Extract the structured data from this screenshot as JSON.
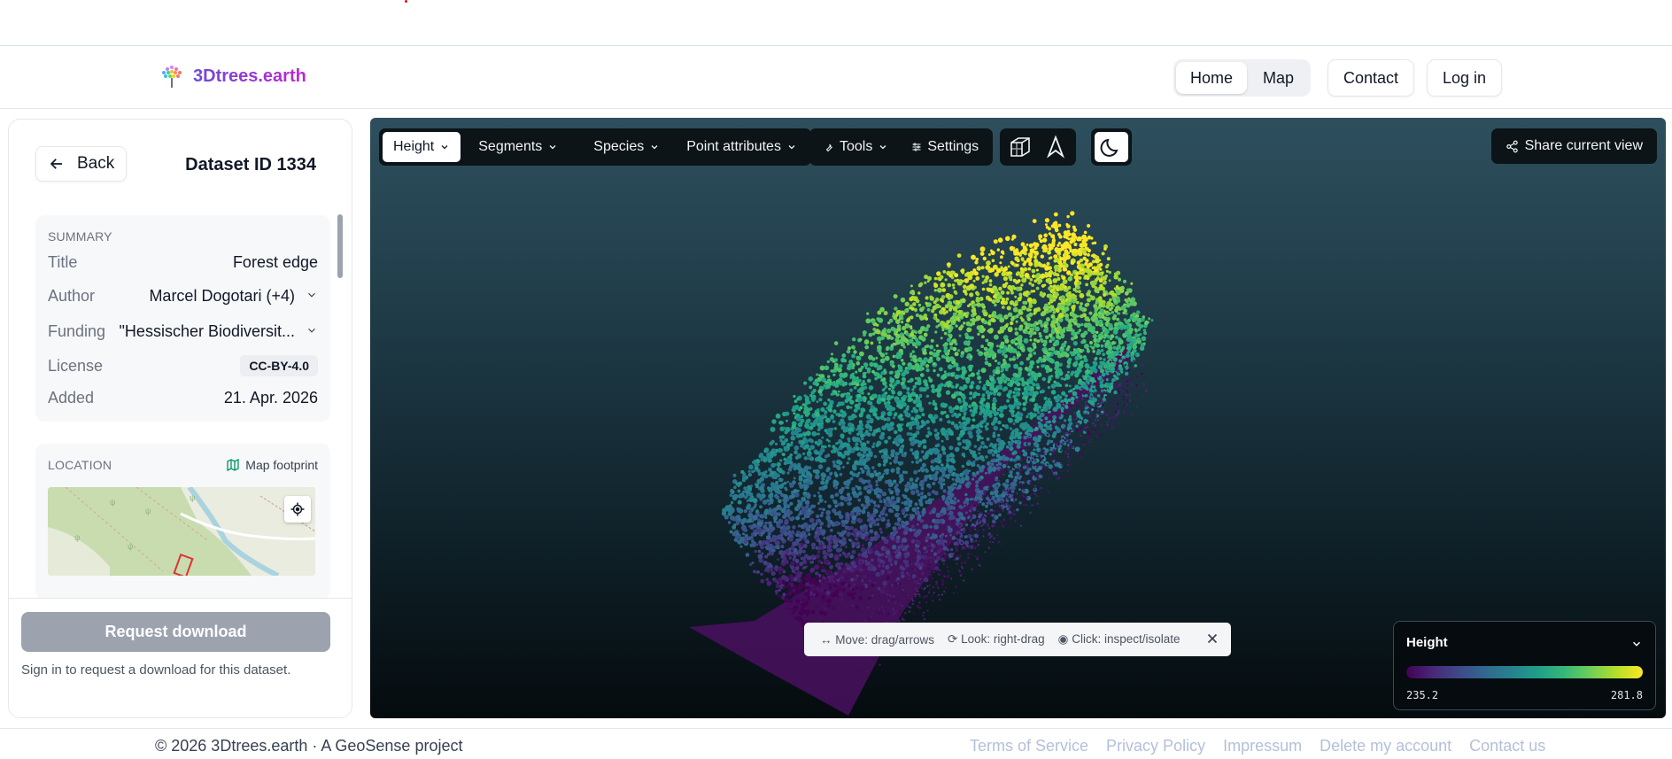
{
  "brand": {
    "name": "3Dtrees.earth",
    "logo_icon": "tree-logo-icon"
  },
  "nav": {
    "home": "Home",
    "map": "Map",
    "contact": "Contact",
    "login": "Log in",
    "active": "Home"
  },
  "sidebar": {
    "back_label": "Back",
    "dataset_title": "Dataset ID 1334",
    "summary": {
      "section": "SUMMARY",
      "title_key": "Title",
      "title_value": "Forest edge",
      "author_key": "Author",
      "author_value": "Marcel Dogotari (+4)",
      "funding_key": "Funding",
      "funding_value": "\"Hessischer Biodiversit...",
      "license_key": "License",
      "license_value": "CC-BY-4.0",
      "added_key": "Added",
      "added_value": "21. Apr. 2026"
    },
    "location": {
      "section": "LOCATION",
      "map_footprint": "Map footprint"
    },
    "request_download": "Request download",
    "request_note": "Sign in to request a download for this dataset."
  },
  "viewer": {
    "toolbar": {
      "height": "Height",
      "segments": "Segments",
      "species": "Species",
      "point_attributes": "Point attributes",
      "tools": "Tools",
      "settings": "Settings"
    },
    "share": "Share current view",
    "hint": {
      "move": "↔ Move: drag/arrows",
      "look": "⟳ Look: right-drag",
      "click": "◉ Click: inspect/isolate"
    },
    "legend": {
      "title": "Height",
      "min": "235.2",
      "max": "281.8",
      "colormap": "viridis"
    }
  },
  "footer": {
    "copyright": "© 2026 3Dtrees.earth · A GeoSense project",
    "links": [
      "Terms of Service",
      "Privacy Policy",
      "Impressum",
      "Delete my account",
      "Contact us"
    ]
  },
  "colors": {
    "accent_start": "#6d4bd8",
    "accent_end": "#c026d3",
    "footer_link": "#b4bfd9",
    "disabled_button": "#9ca3af"
  }
}
